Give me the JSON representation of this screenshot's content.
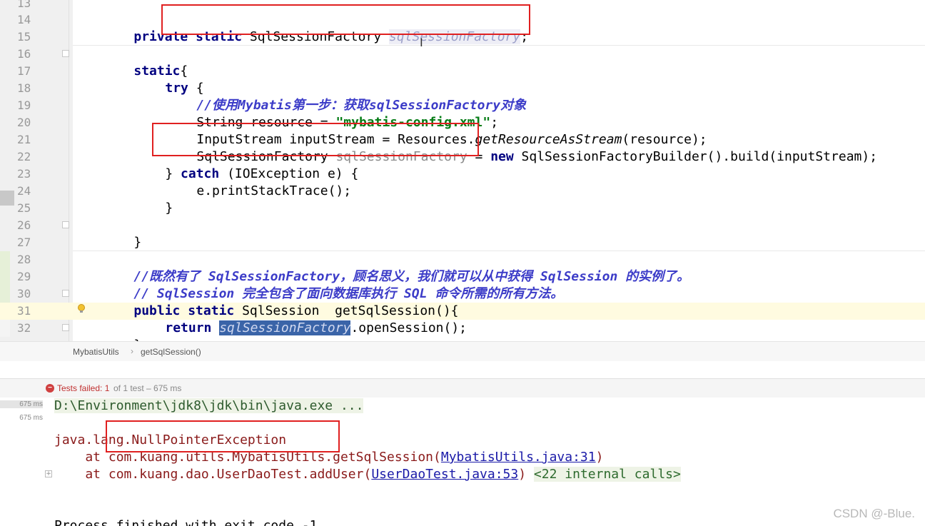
{
  "editor": {
    "line_numbers": [
      "13",
      "14",
      "15",
      "16",
      "17",
      "18",
      "19",
      "20",
      "21",
      "22",
      "23",
      "24",
      "25",
      "26",
      "27",
      "28",
      "29",
      "30",
      "31",
      "32"
    ],
    "lines": {
      "l14": {
        "p1": "private ",
        "p2": "static ",
        "p3": "SqlSessionFactory ",
        "p4": "sqlSessionFactory",
        "p5": ";"
      },
      "l16": {
        "p1": "static",
        "p2": "{"
      },
      "l17": {
        "p1": "try ",
        "p2": "{"
      },
      "l18": {
        "p1": "//使用Mybatis第一步：获取sqlSessionFactory对象"
      },
      "l19": {
        "p1": "String resource = ",
        "p2": "\"mybatis-config.xml\"",
        "p3": ";"
      },
      "l20": {
        "p1": "InputStream inputStream = Resources.",
        "p2": "getResourceAsStream",
        "p3": "(resource);"
      },
      "l21": {
        "p1": "SqlSessionFactory ",
        "p2": "sqlSessionFactory",
        "p3": " = ",
        "p4": "new ",
        "p5": "SqlSessionFactoryBuilder().build(inputStream);"
      },
      "l22": {
        "p1": "} ",
        "p2": "catch ",
        "p3": "(IOException e) {"
      },
      "l23": {
        "p1": "e.printStackTrace();"
      },
      "l24": {
        "p1": "}"
      },
      "l26": {
        "p1": "}"
      },
      "l28": {
        "p1": "//既然有了 SqlSessionFactory，顾名思义，我们就可以从中获得 SqlSession 的实例了。"
      },
      "l29": {
        "p1": "// SqlSession 完全包含了面向数据库执行 SQL 命令所需的所有方法。"
      },
      "l30": {
        "p1": "public ",
        "p2": "static ",
        "p3": "SqlSession  getSqlSession(){"
      },
      "l31": {
        "p1": "return ",
        "p2": "sqlSessionFactory",
        "p3": ".openSession();"
      },
      "l32": {
        "p1": "}"
      }
    }
  },
  "breadcrumb": {
    "class_name": "MybatisUtils",
    "method_name": "getSqlSession()",
    "separator": "›"
  },
  "test_bar": {
    "status": "Tests failed: ",
    "failed_count": "1",
    "rest": " of 1 test – 675 ms"
  },
  "test_tree": {
    "row1": "675 ms",
    "row2": "675 ms"
  },
  "console": {
    "cmd": "D:\\Environment\\jdk8\\jdk\\bin\\java.exe ...",
    "exception": "java.lang.NullPointerException",
    "trace1_prefix": "    at com.kuang.utils.MybatisUtils.getSqlSession(",
    "trace1_link": "MybatisUtils.java:31",
    "trace1_suffix": ")",
    "trace2_prefix": "    at com.kuang.dao.UserDaoTest.addUser(",
    "trace2_link": "UserDaoTest.java:53",
    "trace2_suffix": ") ",
    "trace2_internal": "<22 internal calls>",
    "process": "Process finished with exit code -1"
  },
  "watermark": "CSDN @-Blue.",
  "colors": {
    "highlight_box": "#e02020",
    "selection": "#3a64a8",
    "keyword": "#000080",
    "comment": "#3c3cc8",
    "string": "#067d17"
  }
}
